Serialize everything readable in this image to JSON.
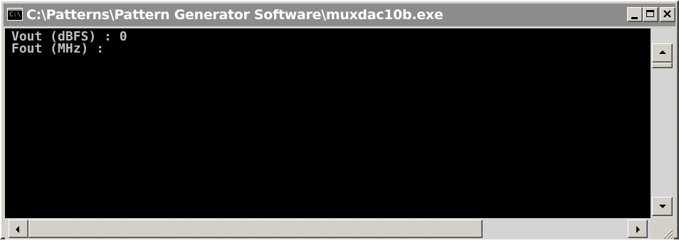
{
  "window": {
    "title": "C:\\Patterns\\Pattern Generator Software\\muxdac10b.exe",
    "icon": "console-icon",
    "title_bar_color": "#8c8c8c",
    "chrome_color": "#d4d0c8"
  },
  "caption_buttons": {
    "minimize": "minimize-icon",
    "maximize": "maximize-icon",
    "close": "close-icon"
  },
  "console": {
    "background": "#000000",
    "text_color": "#c0c0c0",
    "lines": [
      "Vout (dBFS) : 0",
      "Fout (MHz) :"
    ]
  },
  "scrollbars": {
    "vertical": {
      "up": "arrow-up-icon",
      "down": "arrow-down-icon"
    },
    "horizontal": {
      "left": "arrow-left-icon",
      "right": "arrow-right-icon"
    }
  },
  "resize_grip": "resize-grip-icon"
}
